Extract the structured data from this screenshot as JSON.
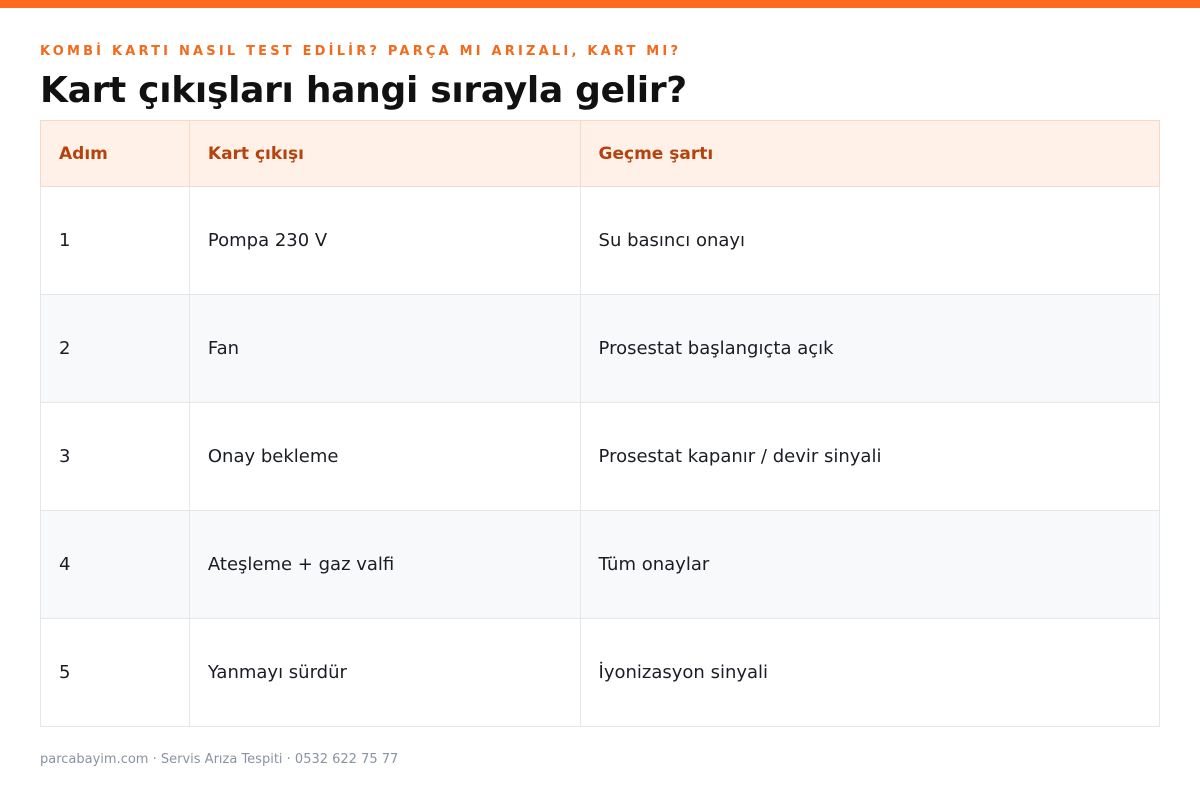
{
  "colors": {
    "accent": "#ff6b1a",
    "eyebrow": "#f26a1b",
    "header_bg": "#fff1e8",
    "header_text": "#b5430f",
    "row_alt_bg": "#f8f9fb",
    "border": "#e3e6ea",
    "footer_text": "#8a93a3"
  },
  "header": {
    "eyebrow": "KOMBİ KARTI NASIL TEST EDİLİR? PARÇA MI ARIZALI, KART MI?",
    "title": "Kart çıkışları hangi sırayla gelir?"
  },
  "table": {
    "columns": [
      "Adım",
      "Kart çıkışı",
      "Geçme şartı"
    ],
    "rows": [
      {
        "step": "1",
        "output": "Pompa 230 V",
        "condition": "Su basıncı onayı"
      },
      {
        "step": "2",
        "output": "Fan",
        "condition": "Prosestat başlangıçta açık"
      },
      {
        "step": "3",
        "output": "Onay bekleme",
        "condition": "Prosestat kapanır / devir sinyali"
      },
      {
        "step": "4",
        "output": "Ateşleme + gaz valfi",
        "condition": "Tüm onaylar"
      },
      {
        "step": "5",
        "output": "Yanmayı sürdür",
        "condition": "İyonizasyon sinyali"
      }
    ]
  },
  "footer": {
    "text": "parcabayim.com · Servis Arıza Tespiti · 0532 622 75 77"
  }
}
